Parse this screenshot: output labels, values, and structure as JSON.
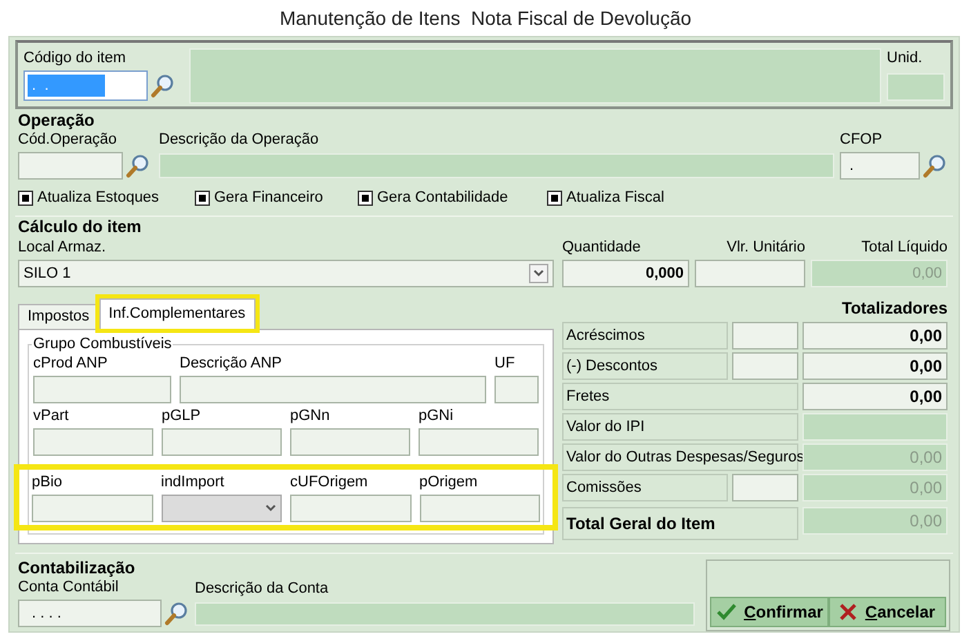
{
  "window": {
    "title": "Manutenção de Itens  Nota Fiscal de Devolução"
  },
  "item": {
    "code_label": "Código do item",
    "code_value": " .  . ",
    "unit_label": "Unid."
  },
  "operation": {
    "title": "Operação",
    "code_label": "Cód.Operação",
    "description_label": "Descrição da Operação",
    "cfop_label": "CFOP",
    "cfop_value": "."
  },
  "options": [
    {
      "label": "Atualiza Estoques",
      "checked": true
    },
    {
      "label": "Gera Financeiro",
      "checked": true
    },
    {
      "label": "Gera Contabilidade",
      "checked": true
    },
    {
      "label": "Atualiza Fiscal",
      "checked": true
    }
  ],
  "calculation": {
    "title": "Cálculo do item",
    "location_label": "Local Armaz.",
    "location_value": "SILO 1",
    "quantity_label": "Quantidade",
    "quantity_value": "0,000",
    "unit_price_label": "Vlr. Unitário",
    "net_total_label": "Total Líquido",
    "net_total_value": "0,00"
  },
  "tabs": [
    {
      "label": "Impostos",
      "selected": false,
      "highlighted": false
    },
    {
      "label": "Inf.Complementares",
      "selected": true,
      "highlighted": true
    }
  ],
  "fuel_group": {
    "title": "Grupo Combustíveis",
    "rows": [
      {
        "highlighted": false,
        "fields": [
          {
            "label": "cProd ANP",
            "kind": "text"
          },
          {
            "label": "Descrição ANP",
            "kind": "text"
          },
          {
            "label": "UF",
            "kind": "text"
          }
        ]
      },
      {
        "highlighted": false,
        "fields": [
          {
            "label": "vPart",
            "kind": "text"
          },
          {
            "label": "pGLP",
            "kind": "text"
          },
          {
            "label": "pGNn",
            "kind": "text"
          },
          {
            "label": "pGNi",
            "kind": "text"
          }
        ]
      },
      {
        "highlighted": true,
        "fields": [
          {
            "label": "pBio",
            "kind": "text"
          },
          {
            "label": "indImport",
            "kind": "select"
          },
          {
            "label": "cUFOrigem",
            "kind": "text"
          },
          {
            "label": "pOrigem",
            "kind": "text"
          }
        ]
      }
    ]
  },
  "totals": {
    "title": "Totalizadores",
    "rows": [
      {
        "label": "Acréscimos",
        "kind": "rate",
        "value": "0,00",
        "editable": true
      },
      {
        "label": "(-) Descontos",
        "kind": "rate",
        "value": "0,00",
        "editable": true
      },
      {
        "label": "Fretes",
        "kind": "plain",
        "value": "0,00",
        "editable": true
      },
      {
        "label": "Valor do IPI",
        "kind": "plain",
        "editable": false
      },
      {
        "label": "Valor do Outras Despesas/Seguros",
        "kind": "plain",
        "value": "0,00",
        "editable": false
      },
      {
        "label": "Comissões",
        "kind": "rate",
        "value": "0,00",
        "editable": false
      },
      {
        "label": "Total Geral do Item",
        "kind": "total",
        "value": "0,00",
        "editable": false
      }
    ]
  },
  "accounting": {
    "title": "Contabilização",
    "account_label": "Conta Contábil",
    "account_value": " . . . .",
    "description_label": "Descrição da Conta"
  },
  "buttons": [
    {
      "label": "Confirmar",
      "kind": "confirm"
    },
    {
      "label": "Cancelar",
      "kind": "cancel"
    }
  ]
}
